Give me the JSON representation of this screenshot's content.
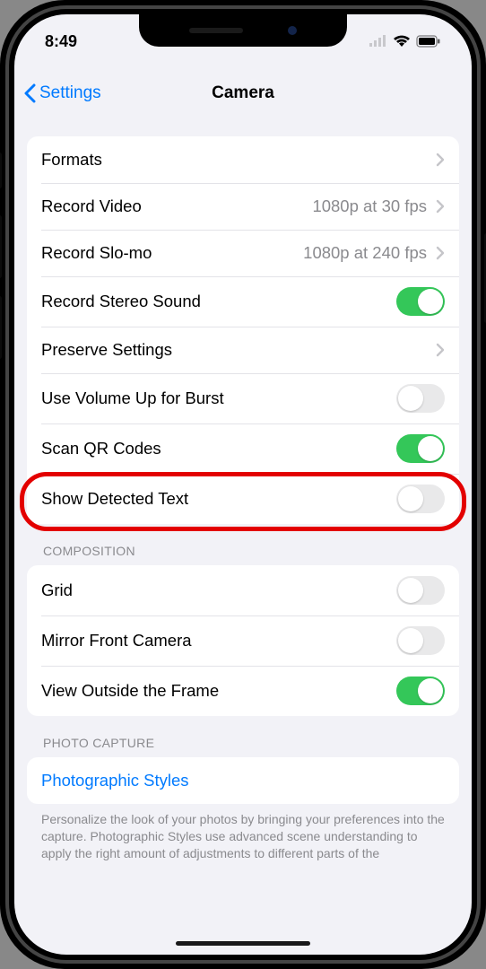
{
  "statusbar": {
    "time": "8:49"
  },
  "nav": {
    "back": "Settings",
    "title": "Camera"
  },
  "group1": {
    "formats": "Formats",
    "record_video": "Record Video",
    "record_video_value": "1080p at 30 fps",
    "record_slomo": "Record Slo-mo",
    "record_slomo_value": "1080p at 240 fps",
    "stereo": "Record Stereo Sound",
    "preserve": "Preserve Settings",
    "volup": "Use Volume Up for Burst",
    "qr": "Scan QR Codes",
    "detected": "Show Detected Text"
  },
  "composition": {
    "header": "COMPOSITION",
    "grid": "Grid",
    "mirror": "Mirror Front Camera",
    "outside": "View Outside the Frame"
  },
  "photo": {
    "header": "PHOTO CAPTURE",
    "styles": "Photographic Styles",
    "footer": "Personalize the look of your photos by bringing your preferences into the capture. Photographic Styles use advanced scene understanding to apply the right amount of adjustments to different parts of the"
  },
  "toggles": {
    "stereo": true,
    "volup": false,
    "qr": true,
    "detected": false,
    "grid": false,
    "mirror": false,
    "outside": true
  }
}
